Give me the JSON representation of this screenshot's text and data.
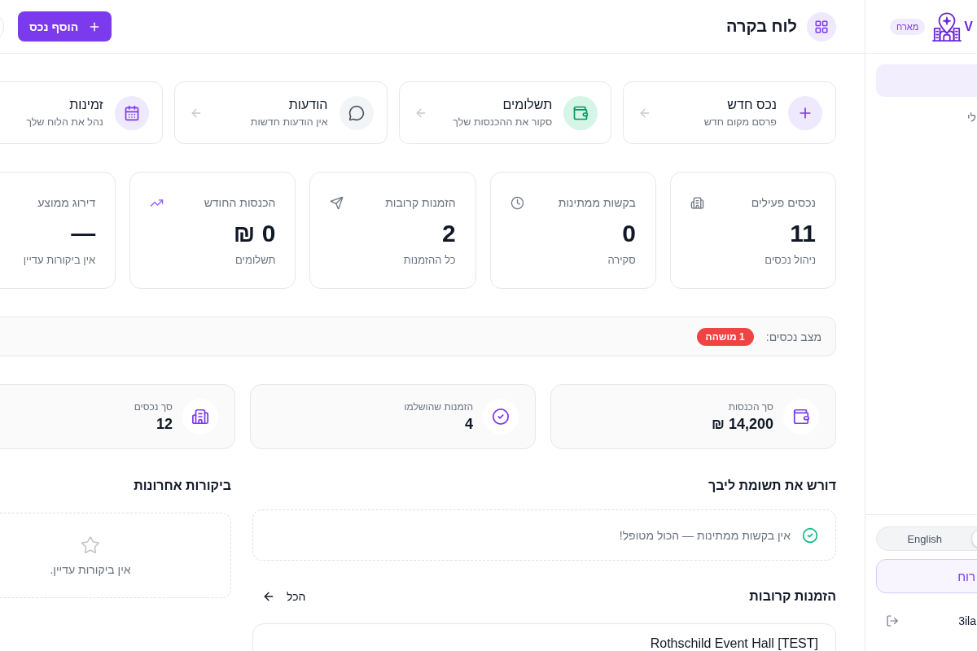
{
  "sidebar": {
    "brand": {
      "name": "V",
      "badge": "מארח"
    },
    "nav": [
      {
        "selected": true
      },
      {
        "label": "לי",
        "selected": false
      }
    ],
    "language_toggle": [
      {
        "selected": true
      },
      {
        "label": "English",
        "selected": false
      }
    ],
    "action_button": {
      "label": "רוח"
    },
    "user": {
      "name": "3ila"
    }
  },
  "header": {
    "title": "לוח בקרה",
    "add_button": "הוסף נכס"
  },
  "quick_actions": [
    {
      "title": "נכס חדש",
      "subtitle": "פרסם מקום חדש"
    },
    {
      "title": "תשלומים",
      "subtitle": "סקור את ההכנסות שלך"
    },
    {
      "title": "הודעות",
      "subtitle": "אין הודעות חדשות"
    },
    {
      "title": "זמינות",
      "subtitle": "נהל את הלוח שלך"
    }
  ],
  "stats": [
    {
      "label": "נכסים פעילים",
      "value": "11",
      "caption": "ניהול נכסים"
    },
    {
      "label": "בקשות ממתינות",
      "value": "0",
      "caption": "סקירה"
    },
    {
      "label": "הזמנות קרובות",
      "value": "2",
      "caption": "כל ההזמנות"
    },
    {
      "label": "הכנסות החודש",
      "value": "0 ₪",
      "caption": "תשלומים"
    },
    {
      "label": "דירוג ממוצע",
      "value": "—",
      "caption": "אין ביקורות עדיין"
    }
  ],
  "property_status": {
    "label": "מצב נכסים:",
    "badges": [
      {
        "text": "1 מושהה"
      }
    ]
  },
  "summary": [
    {
      "label": "סך הכנסות",
      "value": "14,200 ₪"
    },
    {
      "label": "הזמנות שהושלמו",
      "value": "4"
    },
    {
      "label": "סך נכסים",
      "value": "12"
    }
  ],
  "attention": {
    "title": "דורש את תשומת ליבך",
    "empty_message": "אין בקשות ממתינות — הכול מטופל!"
  },
  "upcoming_bookings": {
    "title": "הזמנות קרובות",
    "view_all": "הכל",
    "bookings": [
      {
        "venue": "Rothschild Event Hall [TEST]"
      }
    ]
  },
  "recent_reviews": {
    "title": "ביקורות אחרונות",
    "empty_message": "אין ביקורות עדיין."
  }
}
